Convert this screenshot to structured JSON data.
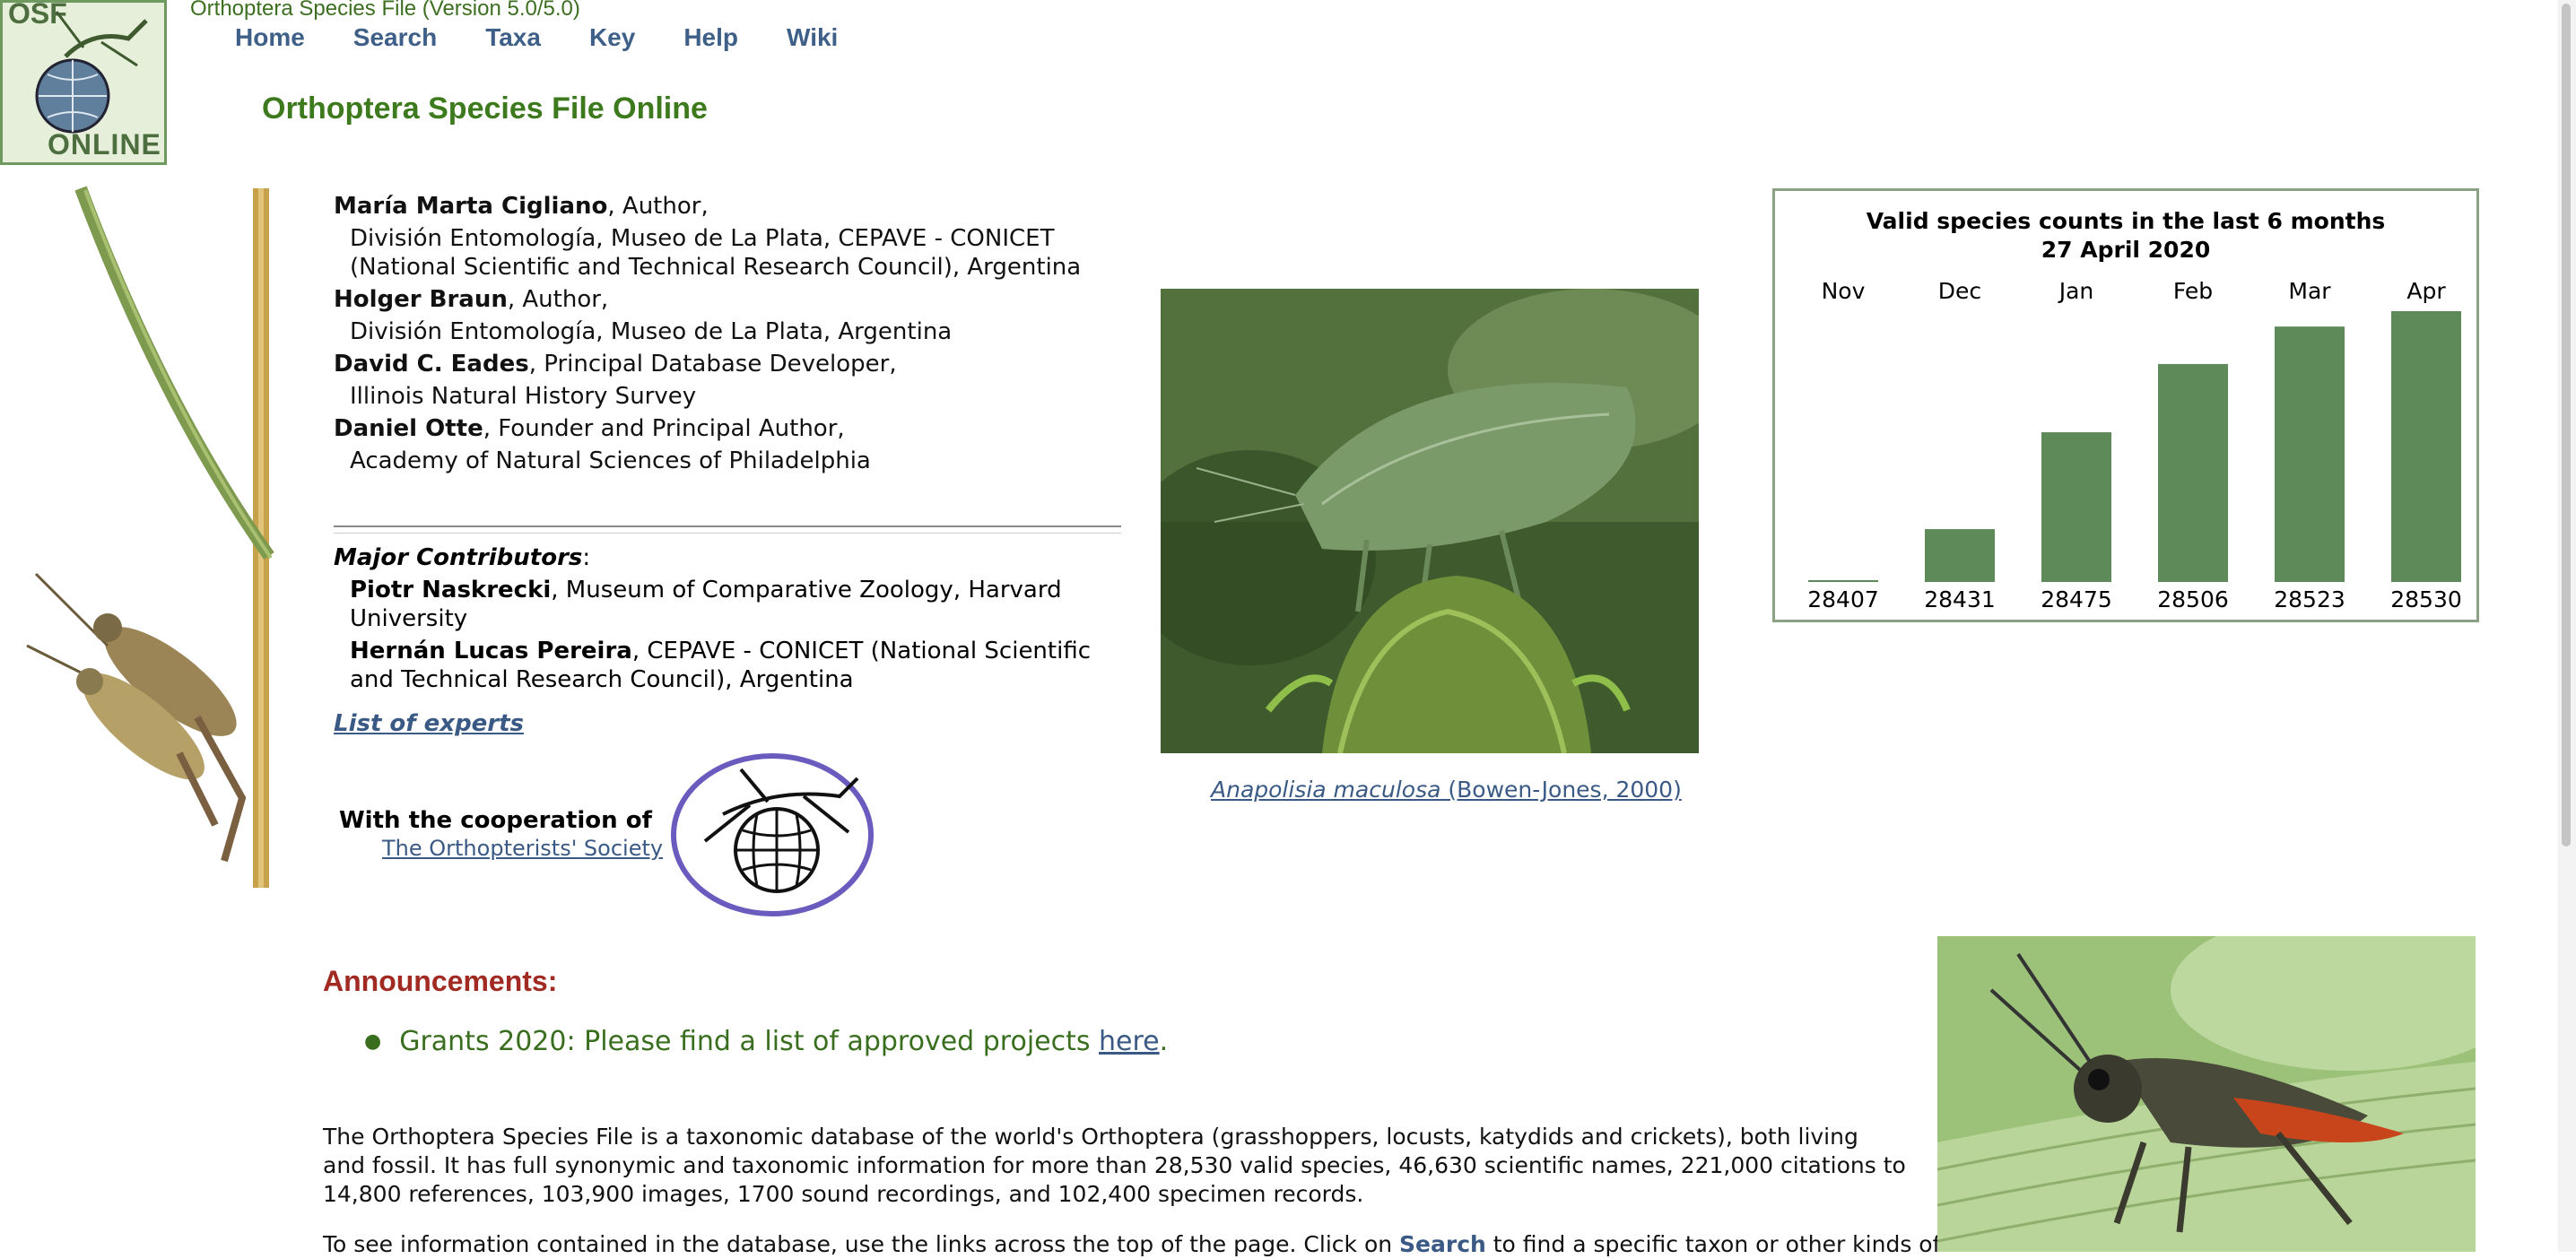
{
  "header": {
    "logo_top_text": "OSF",
    "logo_bottom_text": "ONLINE",
    "version": "Orthoptera Species File (Version 5.0/5.0)",
    "nav": [
      "Home",
      "Search",
      "Taxa",
      "Key",
      "Help",
      "Wiki"
    ],
    "title": "Orthoptera Species File Online"
  },
  "authors": [
    {
      "name": "María Marta Cigliano",
      "role": ", Author,",
      "affiliation": "División Entomología, Museo de La Plata, CEPAVE - CONICET (National Scientific and Technical Research Council), Argentina"
    },
    {
      "name": "Holger Braun",
      "role": ", Author,",
      "affiliation": "División Entomología, Museo de La Plata, Argentina"
    },
    {
      "name": "David C. Eades",
      "role": ", Principal Database Developer,",
      "affiliation": "Illinois Natural History Survey"
    },
    {
      "name": "Daniel Otte",
      "role": ", Founder and Principal Author,",
      "affiliation": "Academy of Natural Sciences of Philadelphia"
    }
  ],
  "contributors": {
    "heading": "Major Contributors",
    "heading_suffix": ":",
    "items": [
      {
        "name": "Piotr Naskrecki",
        "affiliation": ", Museum of Comparative Zoology, Harvard University"
      },
      {
        "name": "Hernán Lucas Pereira",
        "affiliation": ", CEPAVE - CONICET (National Scientific and Technical Research Council), Argentina"
      }
    ]
  },
  "experts_link": "List of experts",
  "cooperation": {
    "label": "With the cooperation of",
    "society": "The Orthopterists' Society"
  },
  "photo_caption": {
    "species": "Anapolisia maculosa",
    "author": " (Bowen-Jones, 2000)"
  },
  "chart_data": {
    "type": "bar",
    "title": "Valid species counts in the last 6 months",
    "subtitle": "27 April 2020",
    "categories": [
      "Nov",
      "Dec",
      "Jan",
      "Feb",
      "Mar",
      "Apr"
    ],
    "values": [
      28407,
      28431,
      28475,
      28506,
      28523,
      28530
    ],
    "ylim": [
      28407,
      28530
    ],
    "bar_color": "#5d8a58",
    "grid": false
  },
  "announcements": {
    "title": "Announcements:",
    "item_text": "Grants 2020: Please find a list of approved projects ",
    "item_link": "here",
    "item_end": "."
  },
  "about_text": "The Orthoptera Species File is a taxonomic database of the world's Orthoptera (grasshoppers, locusts, katydids and crickets), both living and fossil. It has full synonymic and taxonomic information for more than 28,530 valid species, 46,630 scientific names, 221,000 citations to 14,800 references, 103,900 images, 1700 sound recordings, and 102,400 specimen records.",
  "more_text_start": "To see information contained in the database, use the links across the top of the page.  Click on ",
  "more_text_link": "Search",
  "more_text_end": " to find a specific taxon or other kinds of"
}
